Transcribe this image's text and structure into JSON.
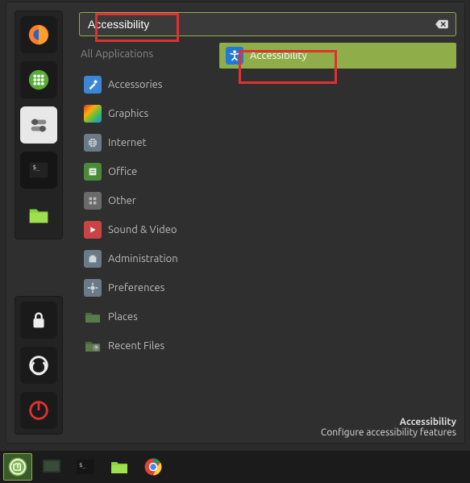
{
  "search": {
    "value": "Accessibility",
    "clear_icon": "backspace-icon"
  },
  "categories": {
    "all": "All Applications",
    "items": [
      {
        "name": "accessories",
        "label": "Accessories"
      },
      {
        "name": "graphics",
        "label": "Graphics"
      },
      {
        "name": "internet",
        "label": "Internet"
      },
      {
        "name": "office",
        "label": "Office"
      },
      {
        "name": "other",
        "label": "Other"
      },
      {
        "name": "sound-video",
        "label": "Sound & Video"
      },
      {
        "name": "administration",
        "label": "Administration"
      },
      {
        "name": "preferences",
        "label": "Preferences"
      },
      {
        "name": "places",
        "label": "Places"
      },
      {
        "name": "recent-files",
        "label": "Recent Files"
      }
    ]
  },
  "results": [
    {
      "name": "accessibility",
      "label": "Accessibility",
      "selected": true
    }
  ],
  "tooltip": {
    "title": "Accessibility",
    "desc": "Configure accessibility features"
  },
  "favorites": [
    {
      "name": "firefox"
    },
    {
      "name": "apps-grid"
    },
    {
      "name": "settings-tweaks"
    },
    {
      "name": "terminal"
    },
    {
      "name": "files"
    }
  ],
  "system_buttons": [
    {
      "name": "lock"
    },
    {
      "name": "logout"
    },
    {
      "name": "power"
    }
  ],
  "taskbar": [
    {
      "name": "mint-menu",
      "active": true
    },
    {
      "name": "show-desktop"
    },
    {
      "name": "terminal"
    },
    {
      "name": "files"
    },
    {
      "name": "chrome"
    }
  ]
}
